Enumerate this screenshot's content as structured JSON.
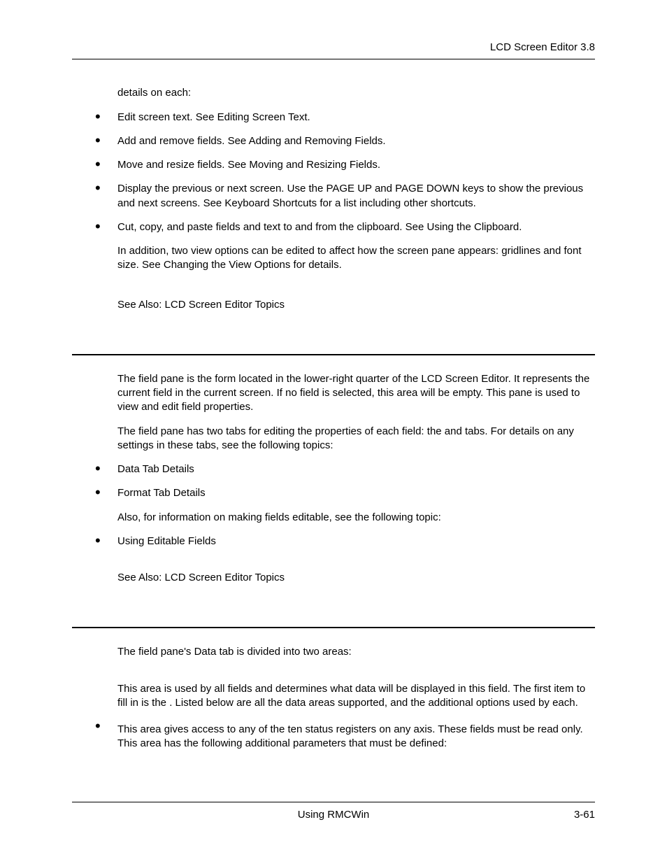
{
  "header": {
    "right": "LCD Screen Editor  3.8"
  },
  "sectionA": {
    "lead": "details on each:",
    "bullets": [
      "Edit screen text. See Editing Screen Text.",
      "Add and remove fields. See Adding and Removing Fields.",
      "Move and resize fields. See Moving and Resizing Fields.",
      "Display the previous or next screen. Use the PAGE UP and PAGE DOWN keys to show the previous and next screens. See Keyboard Shortcuts for a list including other shortcuts.",
      "Cut, copy, and paste fields and text to and from the clipboard. See Using the Clipboard."
    ],
    "afterBullets": "In addition, two view options can be edited to affect how the screen pane appears: gridlines and font size. See Changing the View Options for details.",
    "seeAlso": "See Also: LCD Screen Editor Topics"
  },
  "sectionB": {
    "p1": "The field pane is the form located in the lower-right quarter of the LCD Screen Editor. It represents the current field in the current screen. If no field is selected, this area will be empty. This pane is used to view and edit field properties.",
    "p2": "The field pane has two tabs for editing the properties of each field: the          and              tabs. For details on any settings in these tabs, see the following topics:",
    "bullets": [
      "Data Tab Details",
      "Format Tab Details"
    ],
    "afterBullets": "Also, for information on making fields editable, see the following topic:",
    "bullets2": [
      "Using Editable Fields"
    ],
    "seeAlso": "See Also: LCD Screen Editor Topics"
  },
  "sectionC": {
    "p1": "The field pane's Data tab is divided into two areas:",
    "p2": "This area is used by all fields and determines what data will be displayed in this field. The first item to fill in is the                  . Listed below are all the data areas supported, and the additional options used by each.",
    "bullet1": "This area gives access to any of the ten status registers on any axis. These fields must be read only. This area has the following additional parameters that must be defined:"
  },
  "footer": {
    "center": "Using RMCWin",
    "right": "3-61"
  }
}
